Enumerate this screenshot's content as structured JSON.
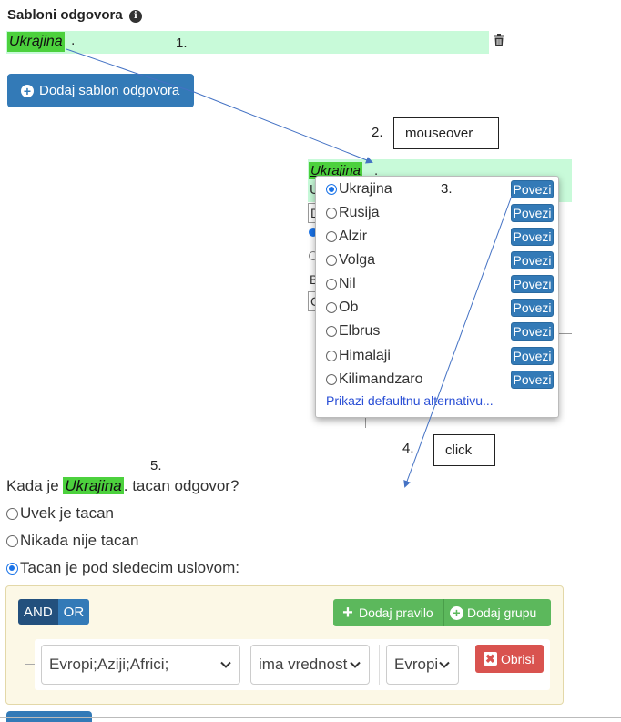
{
  "section": {
    "title": "Sabloni odgovora",
    "template_highlight": "Ukrajina",
    "template_rest": ".",
    "add_button": "Dodaj sablon odgovora"
  },
  "annotations": {
    "step1": "1.",
    "step2": "2.",
    "step3": "3.",
    "step4": "4.",
    "step5": "5.",
    "mouseover": "mouseover",
    "click": "click"
  },
  "background_editor": {
    "highlight": "Ukrajina",
    "rest": ".",
    "fragment_u": "U",
    "fragment_d": "D",
    "fragment_b": "B",
    "fragment_c": "C"
  },
  "popup": {
    "options": [
      {
        "label": "Ukrajina",
        "checked": true
      },
      {
        "label": "Rusija",
        "checked": false
      },
      {
        "label": "Alzir",
        "checked": false
      },
      {
        "label": "Volga",
        "checked": false
      },
      {
        "label": "Nil",
        "checked": false
      },
      {
        "label": "Ob",
        "checked": false
      },
      {
        "label": "Elbrus",
        "checked": false
      },
      {
        "label": "Himalaji",
        "checked": false
      },
      {
        "label": "Kilimandzaro",
        "checked": false
      }
    ],
    "link_button": "Povezi",
    "default_link": "Prikazi defaultnu alternativu..."
  },
  "question": {
    "prefix": "Kada je",
    "highlight": "Ukrajina",
    "suffix": ". tacan odgovor?",
    "options": [
      {
        "label": "Uvek je tacan",
        "checked": false
      },
      {
        "label": "Nikada nije tacan",
        "checked": false
      },
      {
        "label": "Tacan je pod sledecim uslovom:",
        "checked": true
      }
    ]
  },
  "rule_builder": {
    "and_label": "AND",
    "or_label": "OR",
    "add_rule": "Dodaj pravilo",
    "add_group": "Dodaj grupu",
    "field_value": "Evropi;Aziji;Africi;",
    "operator_value": "ima vrednost",
    "value_value": "Evropi",
    "delete_label": "Obrisi"
  },
  "colors": {
    "highlight_green": "#4cd13d",
    "row_green": "#c8fad9",
    "primary": "#337ab7",
    "success": "#5cb85c",
    "danger": "#d9534f",
    "arrow": "#4472c4"
  }
}
